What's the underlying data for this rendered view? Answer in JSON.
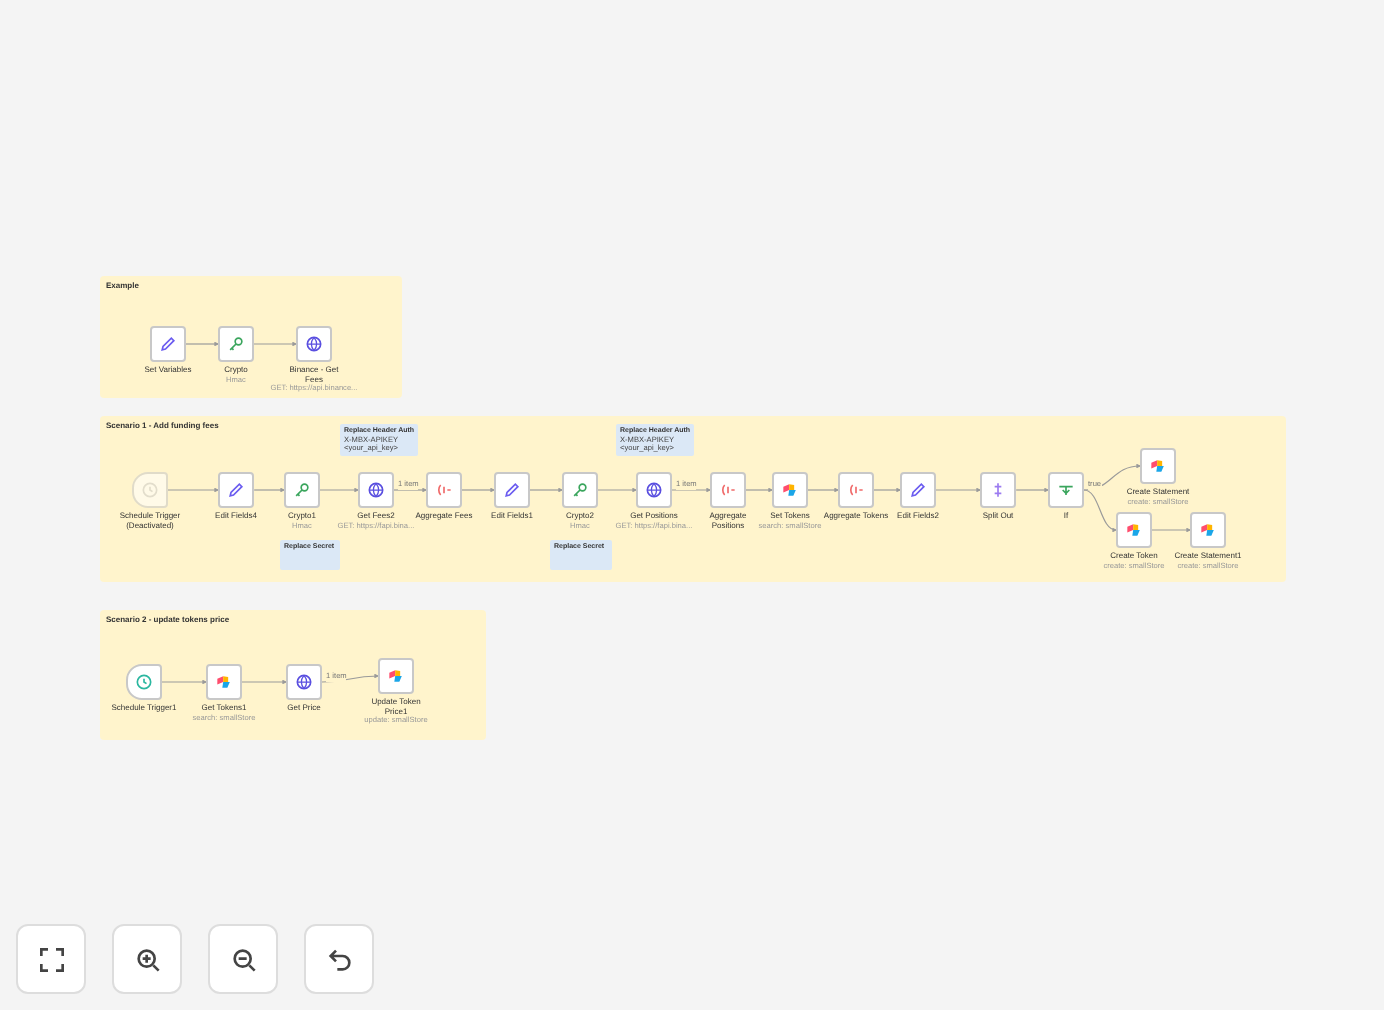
{
  "groups": [
    {
      "title": "Example",
      "nodes": [
        {
          "label": "Set Variables",
          "kind": "pencil",
          "disabled": false
        },
        {
          "label": "Crypto",
          "subtitle": "Hmac",
          "kind": "key",
          "disabled": false
        },
        {
          "label": "Binance - Get Fees",
          "subtitle": "GET: https://api.binance...",
          "kind": "globe",
          "disabled": false
        }
      ]
    },
    {
      "title": "Scenario 1 - Add funding fees",
      "notes": [
        {
          "title": "Replace Header Auth",
          "lines": [
            "X-MBX-APIKEY",
            "<your_api_key>"
          ]
        },
        {
          "title": "Replace Header Auth",
          "lines": [
            "X-MBX-APIKEY",
            "<your_api_key>"
          ]
        },
        {
          "title": "Replace Secret"
        },
        {
          "title": "Replace Secret"
        }
      ],
      "nodes": [
        {
          "label": "Schedule Trigger (Deactivated)",
          "kind": "clock",
          "disabled": true
        },
        {
          "label": "Edit Fields4",
          "kind": "pencil",
          "disabled": false
        },
        {
          "label": "Crypto1",
          "subtitle": "Hmac",
          "kind": "key",
          "disabled": false
        },
        {
          "label": "Get Fees2",
          "subtitle": "GET: https://fapi.bina...",
          "kind": "globe",
          "disabled": false,
          "out_label": "1 item"
        },
        {
          "label": "Aggregate Fees",
          "kind": "aggregate",
          "disabled": false
        },
        {
          "label": "Edit Fields1",
          "kind": "pencil",
          "disabled": false
        },
        {
          "label": "Crypto2",
          "subtitle": "Hmac",
          "kind": "key",
          "disabled": false
        },
        {
          "label": "Get Positions",
          "subtitle": "GET: https://fapi.bina...",
          "kind": "globe",
          "disabled": false,
          "out_label": "1 item"
        },
        {
          "label": "Aggregate Positions",
          "kind": "aggregate",
          "disabled": false
        },
        {
          "label": "Set Tokens",
          "subtitle": "search: smallStore",
          "kind": "store",
          "disabled": false
        },
        {
          "label": "Aggregate Tokens",
          "kind": "aggregate",
          "disabled": false
        },
        {
          "label": "Edit Fields2",
          "kind": "pencil",
          "disabled": false
        },
        {
          "label": "Split Out",
          "kind": "split",
          "disabled": false
        },
        {
          "label": "If",
          "kind": "if",
          "disabled": false,
          "out_label": "true"
        },
        {
          "label": "Create Statement",
          "subtitle": "create: smallStore",
          "kind": "store",
          "disabled": false
        },
        {
          "label": "Create Token",
          "subtitle": "create: smallStore",
          "kind": "store",
          "disabled": false
        },
        {
          "label": "Create Statement1",
          "subtitle": "create: smallStore",
          "kind": "store",
          "disabled": false
        }
      ]
    },
    {
      "title": "Scenario 2 - update tokens price",
      "nodes": [
        {
          "label": "Schedule Trigger1",
          "kind": "clock",
          "disabled": false
        },
        {
          "label": "Get Tokens1",
          "subtitle": "search: smallStore",
          "kind": "store",
          "disabled": false
        },
        {
          "label": "Get Price",
          "kind": "globe",
          "disabled": false,
          "out_label": "1 item"
        },
        {
          "label": "Update Token Price1",
          "subtitle": "update: smallStore",
          "kind": "store",
          "disabled": false
        }
      ]
    }
  ],
  "controls": [
    {
      "kind": "fit"
    },
    {
      "kind": "zoom-in"
    },
    {
      "kind": "zoom-out"
    },
    {
      "kind": "undo"
    }
  ]
}
